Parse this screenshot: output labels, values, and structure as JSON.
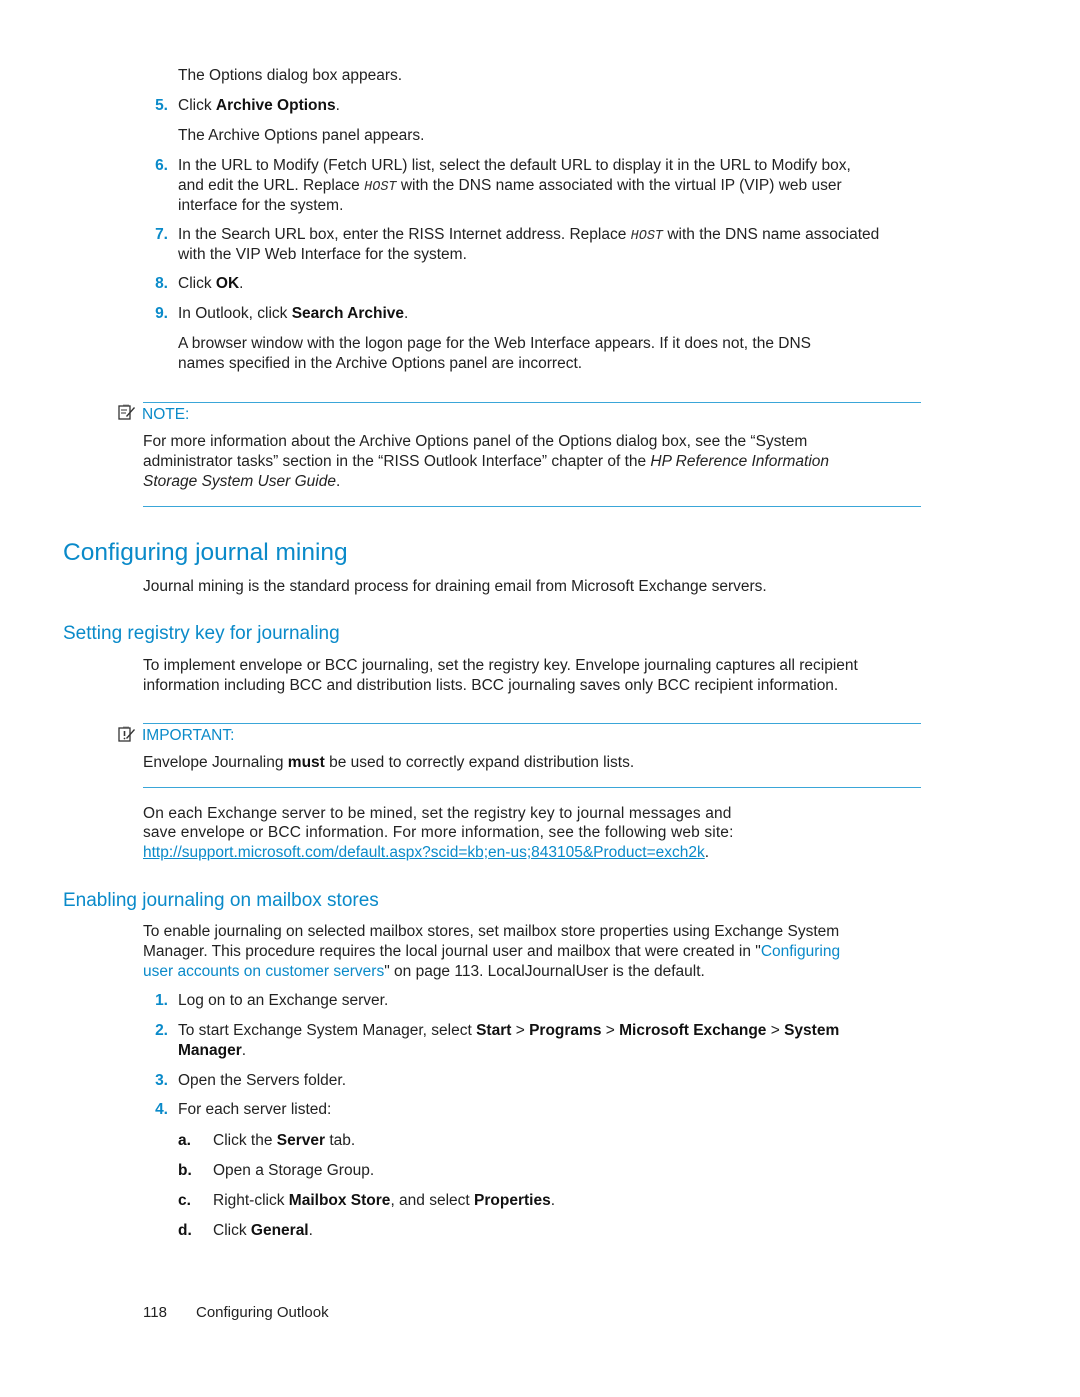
{
  "steps_top": {
    "intro_result": "The Options dialog box appears.",
    "items": [
      {
        "num": "5.",
        "pre": "Click ",
        "bold": "Archive Options",
        "post": ".",
        "result": "The Archive Options panel appears."
      },
      {
        "num": "6.",
        "line1": "In the URL to Modify (Fetch URL) list, select the default URL to display it in the URL to Modify box,",
        "line2_pre": "and edit the URL. Replace ",
        "code": "HOST",
        "line2_post": " with the DNS name associated with the virtual IP (VIP) web user",
        "line3": "interface for the system."
      },
      {
        "num": "7.",
        "line1_pre": "In the Search URL box, enter the RISS Internet address. Replace ",
        "code": "HOST",
        "line1_post": " with the DNS name associated",
        "line2": "with the VIP Web Interface for the system."
      },
      {
        "num": "8.",
        "pre": "Click ",
        "bold": "OK",
        "post": "."
      },
      {
        "num": "9.",
        "pre": "In Outlook, click ",
        "bold": "Search Archive",
        "post": ".",
        "result_line1": "A browser window with the logon page for the Web Interface appears. If it does not, the DNS",
        "result_line2": "names specified in the Archive Options panel are incorrect."
      }
    ]
  },
  "note": {
    "label": "NOTE:",
    "icon": "note-pencil-icon",
    "line1": "For more information about the Archive Options panel of the Options dialog box, see the “System",
    "line2_pre": "administrator tasks” section in the “RISS Outlook Interface” chapter of the ",
    "line2_italic": "HP Reference Information",
    "line3_italic": "Storage System User Guide",
    "line3_post": "."
  },
  "section": {
    "title": "Configuring journal mining",
    "intro": "Journal mining is the standard process for draining email from Microsoft Exchange servers."
  },
  "registry": {
    "title": "Setting registry key for journaling",
    "line1": "To implement envelope or BCC journaling, set the registry key. Envelope journaling captures all recipient",
    "line2": "information including BCC and distribution lists. BCC journaling saves only BCC recipient information.",
    "important": {
      "label": "IMPORTANT:",
      "icon": "important-pencil-icon",
      "pre": "Envelope Journaling ",
      "bold": "must",
      "post": " be used to correctly expand distribution lists."
    },
    "para_line1": "On each Exchange server to be mined, set the registry key to journal messages and",
    "para_line2": "save envelope or BCC information.  For more information, see the following web site:",
    "url": "http://support.microsoft.com/default.aspx?scid=kb;en-us;843105&Product=exch2k",
    "url_post": "."
  },
  "mailbox": {
    "title": "Enabling journaling on mailbox stores",
    "line1": "To enable journaling on selected mailbox stores, set mailbox store properties using Exchange System",
    "line2_pre": "Manager. This procedure requires the local journal user and mailbox that were created in \"",
    "line2_link": "Configuring",
    "line3_link": "user accounts on customer servers",
    "line3_post": "\" on page 113. LocalJournalUser is the default.",
    "steps": [
      {
        "num": "1.",
        "text": "Log on to an Exchange server."
      },
      {
        "num": "2.",
        "pre": "To start Exchange System Manager, select ",
        "b1": "Start",
        "s1": " > ",
        "b2": "Programs",
        "s2": " > ",
        "b3": "Microsoft Exchange",
        "s3": " > ",
        "b4": "System",
        "b5": "Manager",
        "post": "."
      },
      {
        "num": "3.",
        "text": "Open the Servers folder."
      },
      {
        "num": "4.",
        "text": "For each server listed:"
      }
    ],
    "substeps": [
      {
        "letter": "a.",
        "pre": "Click the ",
        "bold": "Server",
        "post": " tab."
      },
      {
        "letter": "b.",
        "text": "Open a Storage Group."
      },
      {
        "letter": "c.",
        "pre": "Right-click ",
        "bold": "Mailbox Store",
        "mid": ", and select ",
        "bold2": "Properties",
        "post": "."
      },
      {
        "letter": "d.",
        "pre": "Click ",
        "bold": "General",
        "post": "."
      }
    ]
  },
  "footer": {
    "page_number": "118",
    "chapter": "Configuring Outlook"
  }
}
